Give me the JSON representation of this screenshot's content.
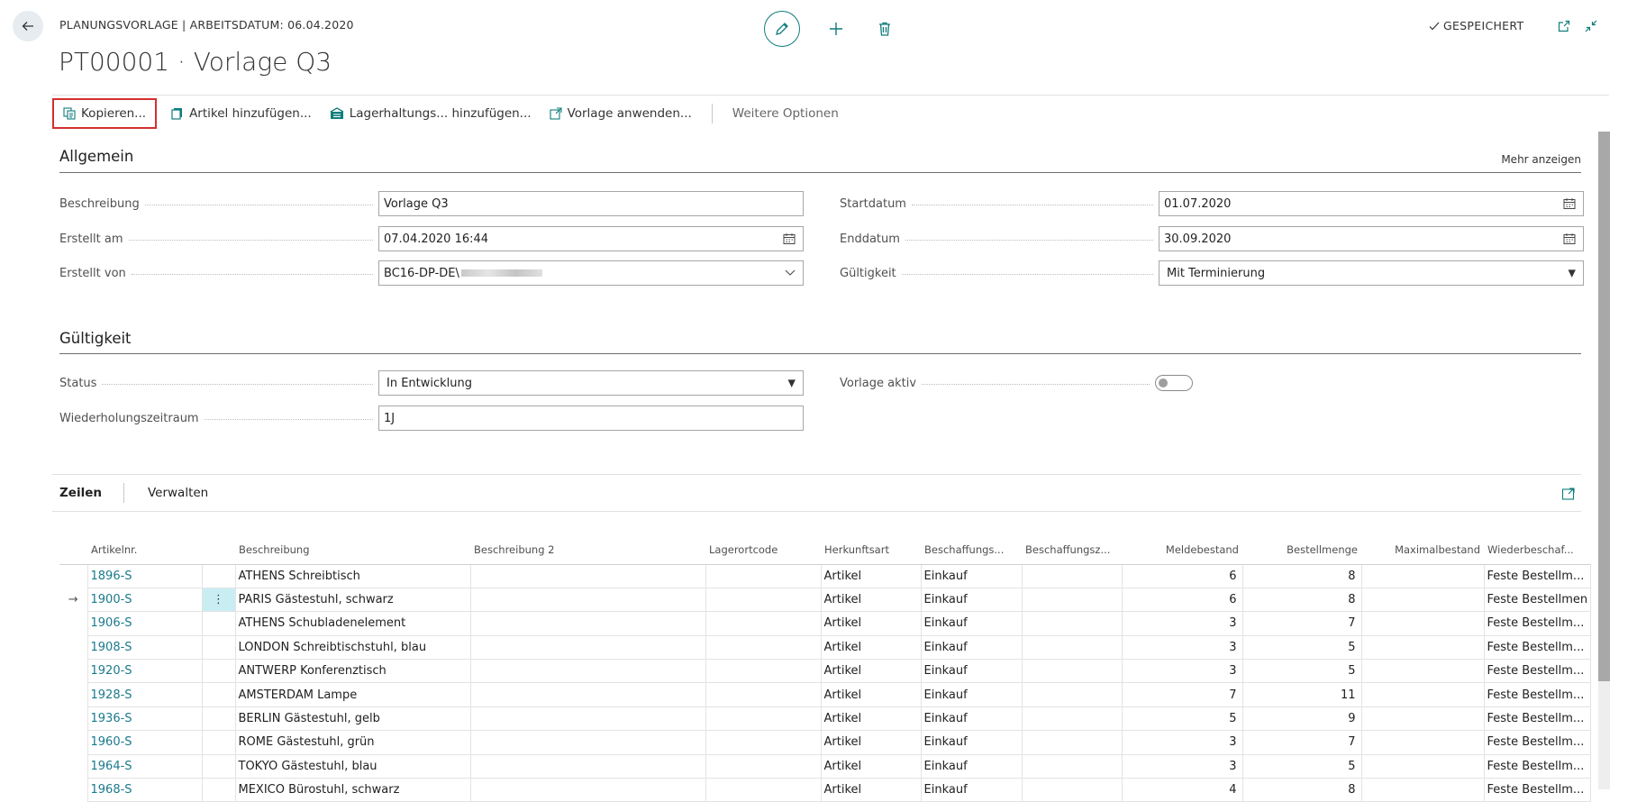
{
  "header": {
    "breadcrumb": "PLANUNGSVORLAGE | ARBEITSDATUM: 06.04.2020",
    "title": "PT00001 · Vorlage Q3",
    "saved_status": "GESPEICHERT"
  },
  "actions": {
    "copy": "Kopieren...",
    "add_items": "Artikel hinzufügen...",
    "add_stock": "Lagerhaltungs... hinzufügen...",
    "apply_template": "Vorlage anwenden...",
    "more_options": "Weitere Optionen"
  },
  "general": {
    "title": "Allgemein",
    "show_more": "Mehr anzeigen",
    "description_label": "Beschreibung",
    "description_value": "Vorlage Q3",
    "created_on_label": "Erstellt am",
    "created_on_value": "07.04.2020 16:44",
    "created_by_label": "Erstellt von",
    "created_by_value": "BC16-DP-DE\\",
    "start_date_label": "Startdatum",
    "start_date_value": "01.07.2020",
    "end_date_label": "Enddatum",
    "end_date_value": "30.09.2020",
    "validity_label": "Gültigkeit",
    "validity_value": "Mit Terminierung"
  },
  "validity": {
    "title": "Gültigkeit",
    "status_label": "Status",
    "status_value": "In Entwicklung",
    "recurrence_label": "Wiederholungszeitraum",
    "recurrence_value": "1J",
    "active_label": "Vorlage aktiv",
    "active": false
  },
  "lines": {
    "tab_lines": "Zeilen",
    "tab_manage": "Verwalten",
    "columns": [
      "Artikelnr.",
      "Beschreibung",
      "Beschreibung 2",
      "Lagerortcode",
      "Herkunftsart",
      "Beschaffungs...",
      "Beschaffungsz...",
      "Meldebestand",
      "Bestellmenge",
      "Maximalbestand",
      "Wiederbeschaf..."
    ],
    "rows": [
      {
        "no": "1896-S",
        "desc": "ATHENS Schreibtisch",
        "desc2": "",
        "loc": "",
        "origin": "Artikel",
        "proc": "Einkauf",
        "procz": "",
        "reorder": "6",
        "qty": "8",
        "max": "",
        "policy": "Feste Bestellm..."
      },
      {
        "no": "1900-S",
        "desc": "PARIS Gästestuhl, schwarz",
        "desc2": "",
        "loc": "",
        "origin": "Artikel",
        "proc": "Einkauf",
        "procz": "",
        "reorder": "6",
        "qty": "8",
        "max": "",
        "policy": "Feste Bestellmen"
      },
      {
        "no": "1906-S",
        "desc": "ATHENS Schubladenelement",
        "desc2": "",
        "loc": "",
        "origin": "Artikel",
        "proc": "Einkauf",
        "procz": "",
        "reorder": "3",
        "qty": "7",
        "max": "",
        "policy": "Feste Bestellm..."
      },
      {
        "no": "1908-S",
        "desc": "LONDON Schreibtischstuhl, blau",
        "desc2": "",
        "loc": "",
        "origin": "Artikel",
        "proc": "Einkauf",
        "procz": "",
        "reorder": "3",
        "qty": "5",
        "max": "",
        "policy": "Feste Bestellm..."
      },
      {
        "no": "1920-S",
        "desc": "ANTWERP Konferenztisch",
        "desc2": "",
        "loc": "",
        "origin": "Artikel",
        "proc": "Einkauf",
        "procz": "",
        "reorder": "3",
        "qty": "5",
        "max": "",
        "policy": "Feste Bestellm..."
      },
      {
        "no": "1928-S",
        "desc": "AMSTERDAM Lampe",
        "desc2": "",
        "loc": "",
        "origin": "Artikel",
        "proc": "Einkauf",
        "procz": "",
        "reorder": "7",
        "qty": "11",
        "max": "",
        "policy": "Feste Bestellm..."
      },
      {
        "no": "1936-S",
        "desc": "BERLIN Gästestuhl, gelb",
        "desc2": "",
        "loc": "",
        "origin": "Artikel",
        "proc": "Einkauf",
        "procz": "",
        "reorder": "5",
        "qty": "9",
        "max": "",
        "policy": "Feste Bestellm..."
      },
      {
        "no": "1960-S",
        "desc": "ROME Gästestuhl, grün",
        "desc2": "",
        "loc": "",
        "origin": "Artikel",
        "proc": "Einkauf",
        "procz": "",
        "reorder": "3",
        "qty": "7",
        "max": "",
        "policy": "Feste Bestellm..."
      },
      {
        "no": "1964-S",
        "desc": "TOKYO Gästestuhl, blau",
        "desc2": "",
        "loc": "",
        "origin": "Artikel",
        "proc": "Einkauf",
        "procz": "",
        "reorder": "3",
        "qty": "5",
        "max": "",
        "policy": "Feste Bestellm..."
      },
      {
        "no": "1968-S",
        "desc": "MEXICO Bürostuhl, schwarz",
        "desc2": "",
        "loc": "",
        "origin": "Artikel",
        "proc": "Einkauf",
        "procz": "",
        "reorder": "4",
        "qty": "8",
        "max": "",
        "policy": "Feste Bestellm..."
      }
    ],
    "selected_row": 1
  },
  "icons": {
    "accent": "#0f7c7c",
    "link": "#1a7a8c",
    "highlight_border": "#d32f2f"
  }
}
